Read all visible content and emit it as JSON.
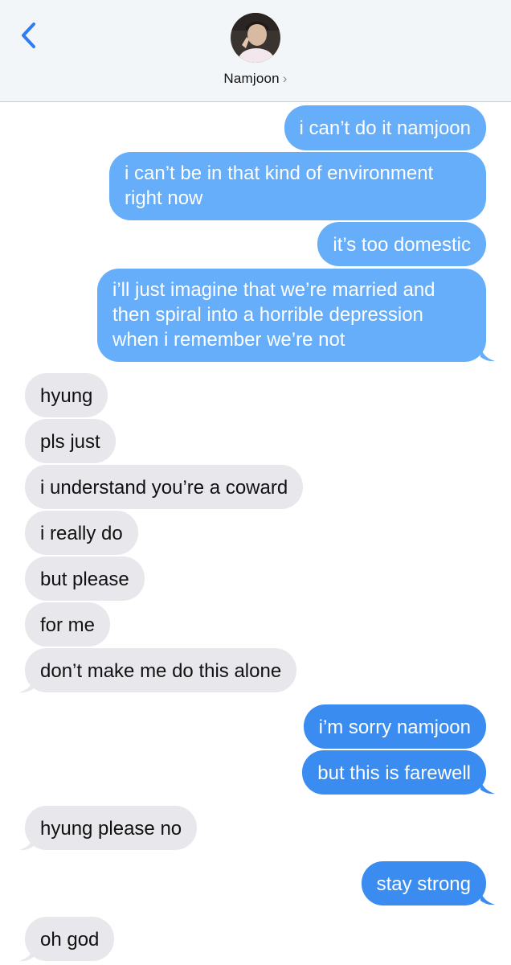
{
  "header": {
    "contact_name": "Namjoon",
    "chevron": "›",
    "back_icon": "chevron-left-icon",
    "avatar_icon": "contact-avatar"
  },
  "colors": {
    "sent_light": "#66adfa",
    "sent_dark": "#3b8cf1",
    "received": "#e8e8ec",
    "accent": "#2f7cf6"
  },
  "messages": [
    {
      "dir": "sent",
      "text": "i can’t do it namjoon"
    },
    {
      "dir": "sent",
      "text": "i can’t be in that kind of environment right now"
    },
    {
      "dir": "sent",
      "text": "it’s too domestic"
    },
    {
      "dir": "sent",
      "text": "i’ll just imagine that we’re married and then spiral into a horrible depression when i remember we’re not"
    },
    {
      "dir": "received",
      "text": "hyung"
    },
    {
      "dir": "received",
      "text": "pls just"
    },
    {
      "dir": "received",
      "text": "i understand you’re a coward"
    },
    {
      "dir": "received",
      "text": "i really do"
    },
    {
      "dir": "received",
      "text": "but please"
    },
    {
      "dir": "received",
      "text": "for me"
    },
    {
      "dir": "received",
      "text": "don’t make me do this alone"
    },
    {
      "dir": "sent",
      "text": "i’m sorry namjoon"
    },
    {
      "dir": "sent",
      "text": "but this is farewell"
    },
    {
      "dir": "received",
      "text": "hyung please no"
    },
    {
      "dir": "sent",
      "text": "stay strong"
    },
    {
      "dir": "received",
      "text": "oh god"
    }
  ]
}
